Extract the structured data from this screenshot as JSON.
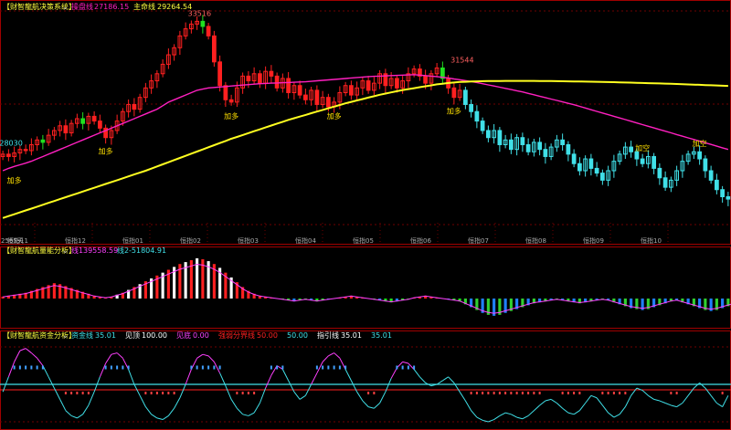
{
  "panel1": {
    "title": "【财智龍航决策系统】",
    "line1_label": "操盘线",
    "line1_value": "27186.15",
    "line2_label": "主命线",
    "line2_value": "29264.54",
    "bottom_left": "2565天",
    "colors": {
      "up": "#ff2020",
      "down": "#40e0e8",
      "line1": "#ff20c0",
      "line2": "#ffff20",
      "title": "#ffff40",
      "buy": "#ffe000"
    }
  },
  "panel2": {
    "title": "【财智龍航量能分析】",
    "line1_label": "线1",
    "line1_value": "39558.59",
    "line2_label": "线2",
    "line2_value": "-51804.91"
  },
  "panel3": {
    "title": "【财智龍航资金分析】",
    "items": [
      {
        "label": "资金线",
        "value": "35.01",
        "color": "#40e0e8"
      },
      {
        "label": "见顶",
        "value": "100.00",
        "color": "#ffffff"
      },
      {
        "label": "见底",
        "value": "0.00",
        "color": "#ff40ff"
      },
      {
        "label": "强弱分界线",
        "value": "50.00",
        "color": "#ff2020"
      },
      {
        "label": "",
        "value": "50.00",
        "color": "#40e0e8"
      },
      {
        "label": "指引线",
        "value": "35.01",
        "color": "#ffffff"
      },
      {
        "label": "",
        "value": "35.01",
        "color": "#40e0e8"
      }
    ]
  },
  "chart_data": [
    {
      "type": "candlestick",
      "price_labels": [
        {
          "text": "33516",
          "value": 33516,
          "index": 34
        },
        {
          "text": "31544",
          "value": 31544,
          "index": 80
        },
        {
          "text": "28030",
          "value": 28030,
          "index": 1
        }
      ],
      "signal_labels": [
        {
          "text": "加多",
          "index": 2
        },
        {
          "text": "加多",
          "index": 18
        },
        {
          "text": "加多",
          "index": 40
        },
        {
          "text": "加多",
          "index": 58
        },
        {
          "text": "加多",
          "index": 79
        },
        {
          "text": "加空",
          "index": 112
        },
        {
          "text": "加空",
          "index": 122
        }
      ],
      "x_tick_labels": [
        "恒指11",
        "恒指12",
        "恒指01",
        "恒指02",
        "恒指03",
        "恒指04",
        "恒指05",
        "恒指06",
        "恒指07",
        "恒指08",
        "恒指09",
        "恒指10"
      ],
      "closes": [
        27900,
        27800,
        27950,
        28100,
        28050,
        28300,
        28500,
        28400,
        28700,
        28900,
        29100,
        28800,
        29200,
        29400,
        29200,
        29500,
        29300,
        29000,
        28600,
        28900,
        29300,
        29700,
        30000,
        29800,
        30300,
        30700,
        31000,
        31300,
        31700,
        32100,
        32400,
        32900,
        33200,
        33400,
        33516,
        33300,
        32900,
        31800,
        30800,
        30200,
        30100,
        30700,
        31200,
        31000,
        31300,
        30900,
        31400,
        31200,
        30700,
        31100,
        30500,
        30800,
        30400,
        30200,
        30600,
        30000,
        30300,
        29900,
        30100,
        30500,
        30800,
        30400,
        30700,
        31000,
        30600,
        30900,
        31300,
        30800,
        31100,
        30700,
        31000,
        31300,
        31500,
        31200,
        30900,
        31300,
        31544,
        31100,
        30700,
        30300,
        30600,
        30000,
        29700,
        29300,
        28900,
        28600,
        28900,
        28300,
        28500,
        28100,
        28600,
        28300,
        28000,
        28400,
        28100,
        27800,
        28200,
        28500,
        28300,
        27900,
        27500,
        27200,
        27700,
        27300,
        27100,
        26800,
        27200,
        27600,
        27900,
        28200,
        28000,
        27700,
        27500,
        27800,
        27300,
        26900,
        26500,
        26800,
        27200,
        27600,
        27900,
        28000,
        27700,
        27200,
        26800,
        26400,
        26100,
        26000
      ],
      "ma_short": [
        27200,
        27300,
        27380,
        27450,
        27520,
        27600,
        27700,
        27800,
        27900,
        28000,
        28100,
        28200,
        28300,
        28400,
        28500,
        28600,
        28700,
        28800,
        28900,
        29000,
        29100,
        29200,
        29300,
        29400,
        29500,
        29600,
        29700,
        29800,
        29950,
        30100,
        30200,
        30300,
        30400,
        30500,
        30600,
        30650,
        30700,
        30720,
        30740,
        30760,
        30780,
        30800,
        30820,
        30840,
        30860,
        30880,
        30890,
        30900,
        30910,
        30920,
        30930,
        30940,
        30950,
        30960,
        30980,
        31000,
        31020,
        31040,
        31060,
        31080,
        31100,
        31120,
        31140,
        31160,
        31180,
        31190,
        31200,
        31210,
        31220,
        31230,
        31240,
        31250,
        31260,
        31240,
        31220,
        31200,
        31180,
        31150,
        31120,
        31080,
        31050,
        31010,
        30970,
        30930,
        30880,
        30830,
        30780,
        30730,
        30680,
        30630,
        30580,
        30530,
        30470,
        30410,
        30350,
        30290,
        30230,
        30170,
        30110,
        30050,
        29990,
        29920,
        29850,
        29780,
        29710,
        29640,
        29570,
        29500,
        29430,
        29360,
        29290,
        29220,
        29150,
        29080,
        29010,
        28940,
        28870,
        28800,
        28730,
        28660,
        28590,
        28520,
        28450,
        28380,
        28310,
        28240,
        28170,
        28100
      ],
      "ma_long": [
        25200,
        25280,
        25360,
        25440,
        25520,
        25600,
        25680,
        25760,
        25840,
        25920,
        26000,
        26080,
        26160,
        26240,
        26320,
        26400,
        26480,
        26560,
        26640,
        26720,
        26800,
        26880,
        26960,
        27040,
        27120,
        27200,
        27290,
        27380,
        27470,
        27560,
        27650,
        27740,
        27830,
        27920,
        28010,
        28100,
        28190,
        28280,
        28370,
        28460,
        28550,
        28630,
        28710,
        28790,
        28870,
        28950,
        29030,
        29110,
        29190,
        29270,
        29350,
        29420,
        29490,
        29560,
        29630,
        29700,
        29770,
        29840,
        29910,
        29980,
        30050,
        30110,
        30170,
        30230,
        30290,
        30350,
        30410,
        30460,
        30510,
        30560,
        30610,
        30650,
        30690,
        30730,
        30770,
        30810,
        30850,
        30880,
        30910,
        30930,
        30950,
        30960,
        30970,
        30980,
        30985,
        30990,
        30992,
        30994,
        30996,
        30997,
        30998,
        30998,
        30997,
        30996,
        30994,
        30992,
        30990,
        30987,
        30984,
        30980,
        30976,
        30972,
        30968,
        30963,
        30958,
        30953,
        30948,
        30942,
        30936,
        30930,
        30924,
        30917,
        30910,
        30903,
        30896,
        30889,
        30881,
        30873,
        30865,
        30857,
        30849,
        30840,
        30831,
        30822,
        30813,
        30804,
        30795,
        30785
      ]
    },
    {
      "type": "bar",
      "series_names": [
        "线1",
        "线2"
      ],
      "values": [
        2,
        3,
        4,
        5,
        6,
        8,
        10,
        12,
        14,
        16,
        15,
        13,
        11,
        9,
        7,
        5,
        3,
        2,
        1,
        2,
        4,
        6,
        9,
        12,
        15,
        18,
        21,
        24,
        27,
        30,
        33,
        36,
        38,
        40,
        42,
        41,
        39,
        36,
        32,
        27,
        22,
        17,
        12,
        8,
        5,
        3,
        2,
        1,
        0,
        -1,
        -2,
        -3,
        -2,
        -1,
        -2,
        -3,
        -2,
        -1,
        0,
        1,
        2,
        3,
        2,
        1,
        0,
        -1,
        -2,
        -3,
        -4,
        -3,
        -2,
        -1,
        1,
        2,
        3,
        2,
        1,
        0,
        -1,
        -2,
        -3,
        -6,
        -9,
        -12,
        -15,
        -17,
        -18,
        -17,
        -15,
        -13,
        -11,
        -9,
        -7,
        -5,
        -4,
        -3,
        -2,
        -1,
        -2,
        -3,
        -4,
        -5,
        -4,
        -3,
        -2,
        -1,
        -2,
        -4,
        -6,
        -8,
        -10,
        -11,
        -12,
        -11,
        -9,
        -7,
        -5,
        -3,
        -2,
        -4,
        -6,
        -8,
        -10,
        -12,
        -13,
        -12,
        -10,
        -8,
        -6,
        -4,
        -2
      ]
    },
    {
      "type": "line",
      "series_names": [
        "资金线",
        "指引线"
      ],
      "ylim": [
        0,
        100
      ],
      "levels": [
        0,
        50,
        100
      ],
      "values": [
        40,
        60,
        80,
        95,
        98,
        92,
        85,
        75,
        60,
        45,
        30,
        15,
        8,
        5,
        10,
        22,
        40,
        60,
        78,
        90,
        92,
        85,
        70,
        50,
        35,
        20,
        10,
        5,
        3,
        8,
        18,
        32,
        50,
        70,
        85,
        90,
        88,
        80,
        65,
        48,
        30,
        18,
        10,
        8,
        12,
        25,
        45,
        62,
        75,
        70,
        55,
        40,
        30,
        35,
        50,
        65,
        80,
        88,
        92,
        85,
        70,
        55,
        40,
        28,
        20,
        18,
        25,
        40,
        58,
        72,
        80,
        78,
        70,
        60,
        52,
        48,
        50,
        55,
        60,
        52,
        40,
        28,
        15,
        6,
        2,
        0,
        3,
        8,
        12,
        10,
        6,
        4,
        8,
        15,
        22,
        28,
        30,
        25,
        18,
        12,
        10,
        15,
        25,
        35,
        32,
        22,
        12,
        6,
        10,
        20,
        35,
        45,
        42,
        35,
        30,
        28,
        25,
        22,
        20,
        25,
        35,
        45,
        52,
        45,
        35,
        25,
        20,
        35
      ]
    }
  ]
}
